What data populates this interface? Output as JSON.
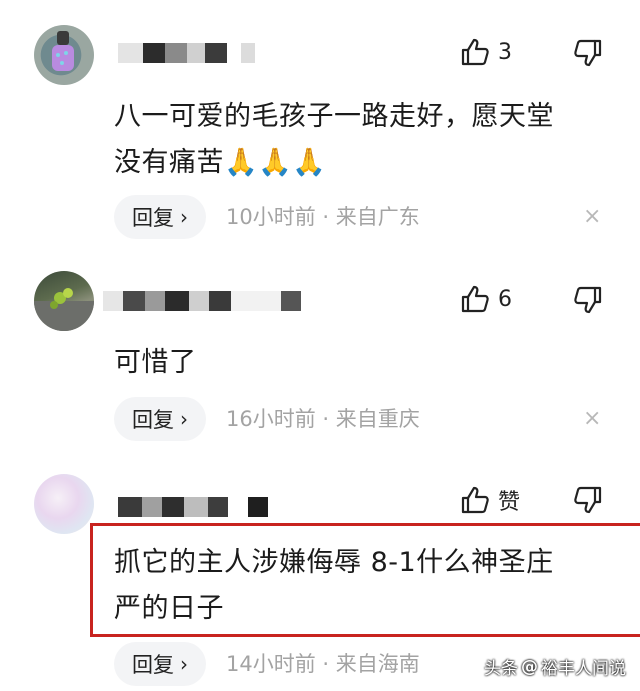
{
  "comments": [
    {
      "likes": "3",
      "text_line1": "八一可爱的毛孩子一路走好，愿天堂",
      "text_line2": "没有痛苦🙏🙏🙏",
      "reply_label": "回复",
      "meta": "10小时前 · 来自广东"
    },
    {
      "likes": "6",
      "text_line1": "可惜了",
      "reply_label": "回复",
      "meta": "16小时前 · 来自重庆"
    },
    {
      "likes": "赞",
      "text_line1": "抓它的主人涉嫌侮辱 8-1什么神圣庄",
      "text_line2": "严的日子",
      "reply_label": "回复",
      "meta": "14小时前 · 来自海南"
    }
  ],
  "icons": {
    "like": "thumb-up-icon",
    "dislike": "thumb-down-icon",
    "close": "close-icon",
    "chevron": "chevron-right-icon"
  },
  "close_glyph": "×",
  "chevron_glyph": "›",
  "watermark": {
    "prefix": "头条",
    "at": "@",
    "name": "裕丰人间说"
  },
  "colors": {
    "highlight": "#c8231f",
    "meta": "#a3a3a3",
    "reply_bg": "#f3f4f6"
  }
}
